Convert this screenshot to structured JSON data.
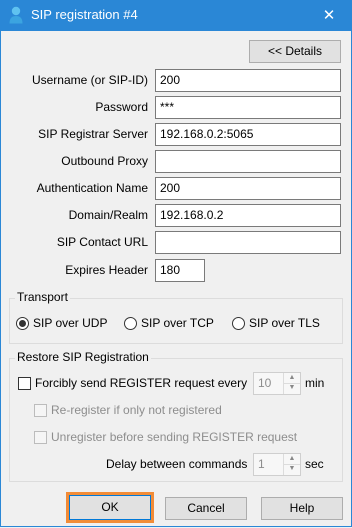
{
  "window": {
    "title": "SIP registration #4",
    "close_glyph": "✕"
  },
  "details_button": "<< Details",
  "fields": [
    {
      "label": "Username (or SIP-ID)",
      "value": "200"
    },
    {
      "label": "Password",
      "value": "***"
    },
    {
      "label": "SIP Registrar Server",
      "value": "192.168.0.2:5065"
    },
    {
      "label": "Outbound Proxy",
      "value": ""
    },
    {
      "label": "Authentication Name",
      "value": "200"
    },
    {
      "label": "Domain/Realm",
      "value": "192.168.0.2"
    },
    {
      "label": "SIP Contact URL",
      "value": ""
    }
  ],
  "expires": {
    "label": "Expires Header",
    "value": "180"
  },
  "transport": {
    "title": "Transport",
    "options": [
      "SIP over UDP",
      "SIP over TCP",
      "SIP over TLS"
    ],
    "selected": "SIP over UDP"
  },
  "restore": {
    "title": "Restore SIP Registration",
    "forcibly_label": "Forcibly send REGISTER request every",
    "forcibly_value": "10",
    "forcibly_unit": "min",
    "reregister_label": "Re-register if only not registered",
    "unregister_label": "Unregister before sending REGISTER request",
    "delay_label": "Delay between commands",
    "delay_value": "1",
    "delay_unit": "sec"
  },
  "buttons": {
    "ok": "OK",
    "cancel": "Cancel",
    "help": "Help"
  },
  "colors": {
    "titlebar": "#2a87d6",
    "focus_highlight": "#f28c38",
    "default_button_border": "#0078d7"
  },
  "icons": {
    "title": "user-icon",
    "close": "close-icon",
    "spin_up": "arrow-up-icon",
    "spin_down": "arrow-down-icon"
  }
}
